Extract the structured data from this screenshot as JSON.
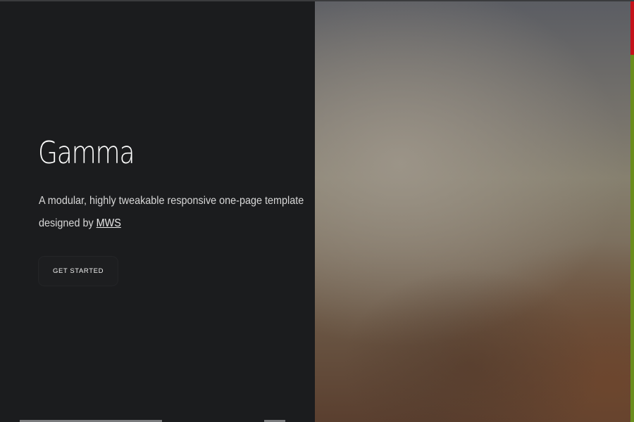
{
  "hero": {
    "title": "Gamma",
    "description_prefix": "A modular, highly tweakable responsive one-page template designed by ",
    "author_link": "MWS",
    "cta_label": "GET STARTED"
  },
  "colors": {
    "background": "#1b1c1e",
    "scrollbar_track": "#6a8d1d",
    "scrollbar_thumb": "#c5121a"
  }
}
